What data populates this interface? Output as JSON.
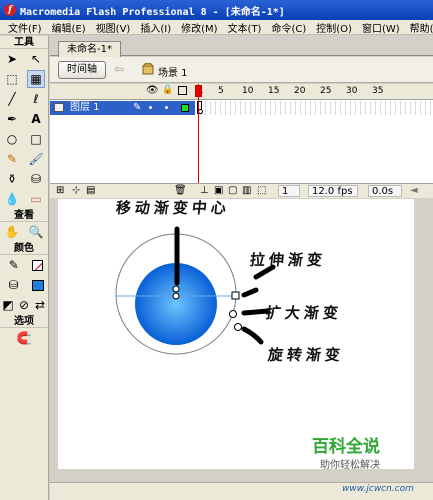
{
  "window": {
    "title": "Macromedia Flash Professional 8 - [未命名-1*]"
  },
  "menu": [
    "文件(F)",
    "编辑(E)",
    "视图(V)",
    "插入(I)",
    "修改(M)",
    "文本(T)",
    "命令(C)",
    "控制(O)",
    "窗口(W)",
    "帮助(H)"
  ],
  "tools": {
    "heading": "工具",
    "view_heading": "查看",
    "colors_heading": "颜色",
    "options_heading": "选项"
  },
  "document": {
    "tab": "未命名-1*",
    "timeline_button": "时间轴",
    "scene": "场景 1"
  },
  "timeline": {
    "layer_name": "图层 1",
    "ruler": [
      "1",
      "5",
      "10",
      "15",
      "20",
      "25",
      "30",
      "35"
    ],
    "current_frame": "1",
    "frame_rate": "12.0 fps",
    "elapsed": "0.0s"
  },
  "annotations": {
    "move_center": "移动渐变中心",
    "stretch": "拉伸渐变",
    "expand": "扩大渐变",
    "rotate": "旋转渐变"
  },
  "watermark": {
    "brand": "百科全说",
    "slogan": "助你轻松解决",
    "url": "www.jcwcn.com"
  },
  "colors": {
    "fill": "#1f7fe0",
    "layer_highlight": "#2d61c8",
    "titlebar": "#0a3fb5"
  }
}
